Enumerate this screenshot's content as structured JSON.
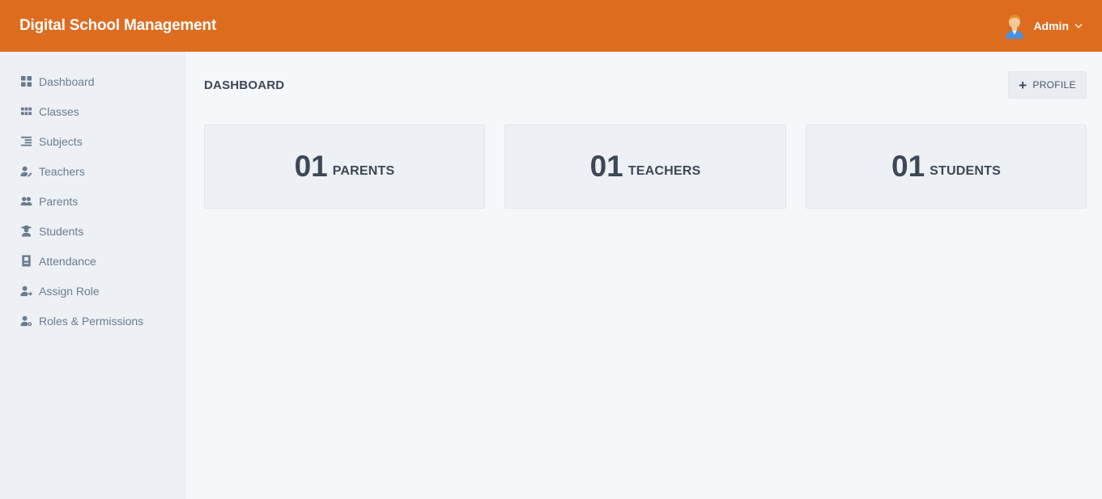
{
  "header": {
    "app_title": "Digital School Management",
    "user_name": "Admin",
    "brand_color": "#de6c1f"
  },
  "sidebar": {
    "items": [
      {
        "label": "Dashboard",
        "icon": "dashboard-icon"
      },
      {
        "label": "Classes",
        "icon": "grid-icon"
      },
      {
        "label": "Subjects",
        "icon": "list-indent-icon"
      },
      {
        "label": "Teachers",
        "icon": "user-pen-icon"
      },
      {
        "label": "Parents",
        "icon": "users-icon"
      },
      {
        "label": "Students",
        "icon": "graduate-icon"
      },
      {
        "label": "Attendance",
        "icon": "address-book-icon"
      },
      {
        "label": "Assign Role",
        "icon": "user-arrow-icon"
      },
      {
        "label": "Roles & Permissions",
        "icon": "user-gear-icon"
      }
    ]
  },
  "main": {
    "page_title": "DASHBOARD",
    "profile_button": "PROFILE",
    "cards": [
      {
        "count": "01",
        "label": "PARENTS"
      },
      {
        "count": "01",
        "label": "TEACHERS"
      },
      {
        "count": "01",
        "label": "STUDENTS"
      }
    ]
  }
}
